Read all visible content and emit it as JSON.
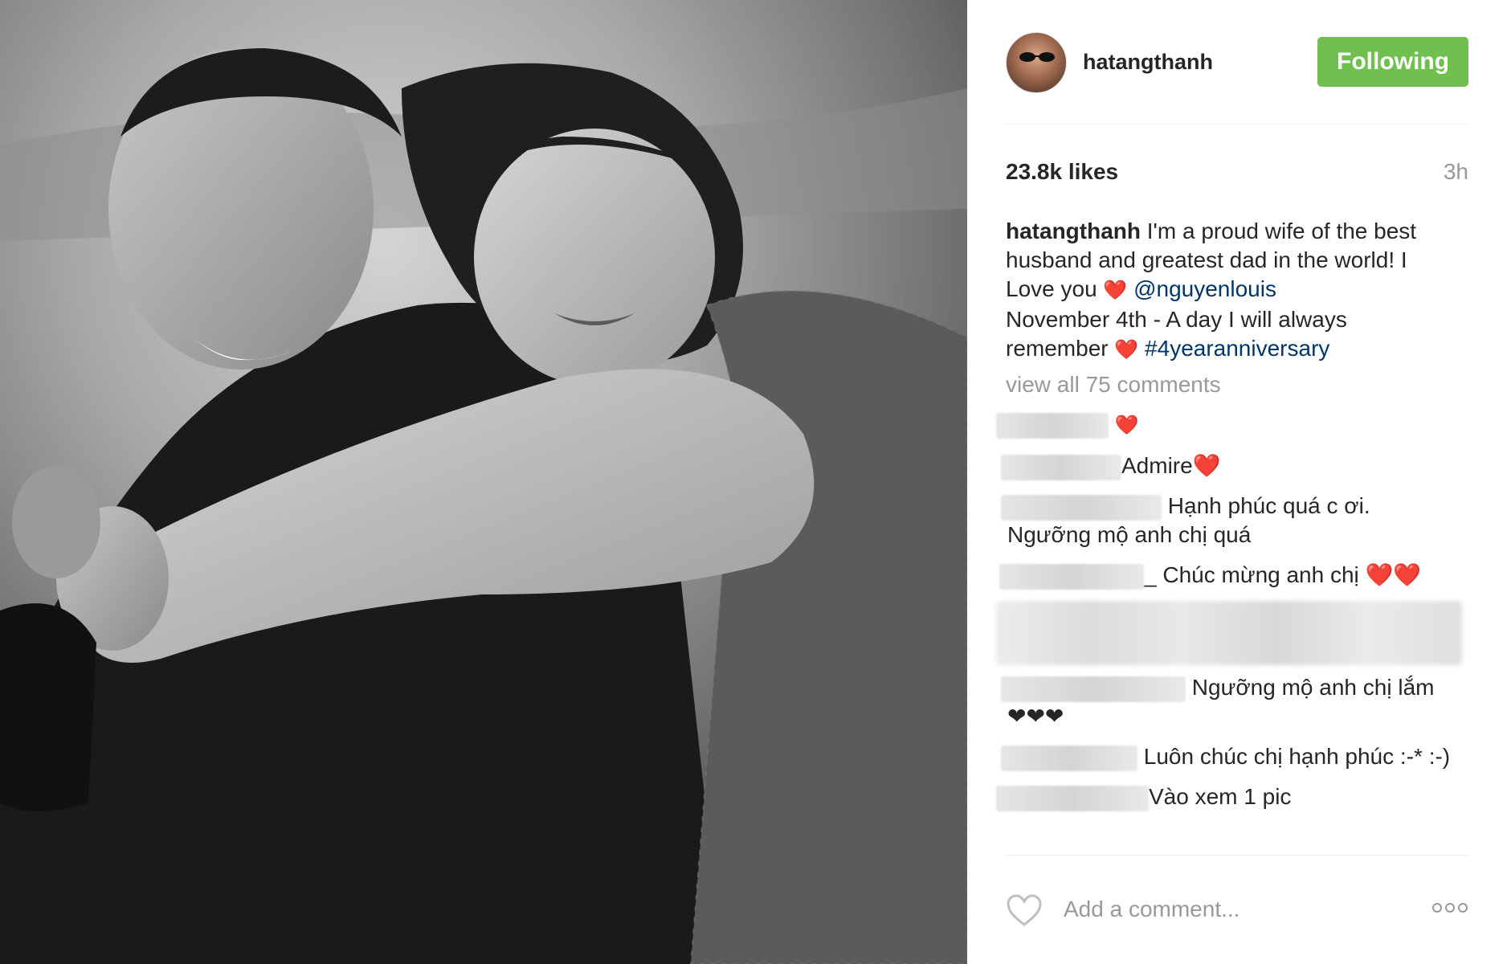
{
  "post": {
    "username": "hatangthanh",
    "follow_label": "Following",
    "likes": "23.8k likes",
    "time": "3h",
    "caption": {
      "user": "hatangthanh",
      "line1": "I'm a proud wife of the best husband and greatest dad in the world! I Love you",
      "heart": "❤️",
      "mention": "@nguyenlouis",
      "line2": "November 4th - A day I will always remember",
      "hashtag": "#4yearanniversary"
    },
    "view_all": "view all 75 comments",
    "comments": [
      {
        "text": "❤️"
      },
      {
        "text": "Admire❤️"
      },
      {
        "text": "Hạnh phúc quá c ơi.",
        "text2": "Ngưỡng mộ anh chị quá"
      },
      {
        "text": "_ Chúc mừng anh chị ❤️❤️"
      },
      {
        "text": "Ngưỡng mộ anh chị lắm",
        "text2": "❤❤❤"
      },
      {
        "text": "Luôn chúc chị hạnh phúc :-* :-)"
      },
      {
        "text": "Vào xem 1 pic"
      }
    ],
    "add_comment_placeholder": "Add a comment...",
    "icons": {
      "like": "heart-outline-icon",
      "more": "more-dots-icon"
    },
    "colors": {
      "follow_bg": "#70c050",
      "link": "#003569",
      "muted": "#999999"
    }
  }
}
